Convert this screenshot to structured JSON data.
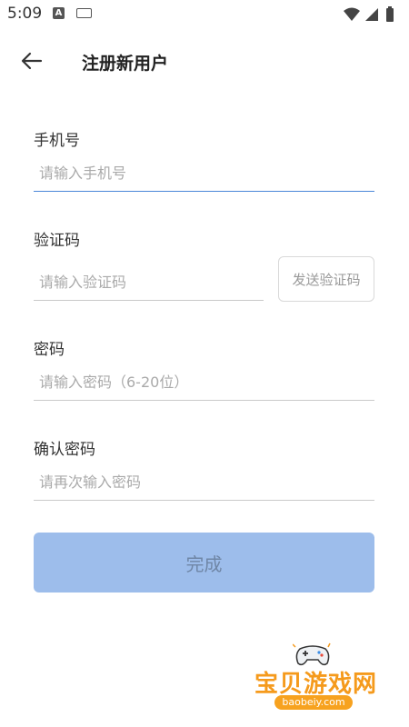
{
  "status_bar": {
    "time": "5:09",
    "left_icons": [
      "a-notification-icon",
      "keyboard-icon"
    ],
    "right_icons": [
      "wifi-icon",
      "signal-icon",
      "battery-icon"
    ]
  },
  "header": {
    "title": "注册新用户",
    "back_icon": "arrow-left-icon"
  },
  "form": {
    "phone": {
      "label": "手机号",
      "placeholder": "请输入手机号",
      "value": ""
    },
    "code": {
      "label": "验证码",
      "placeholder": "请输入验证码",
      "value": "",
      "send_button": "发送验证码"
    },
    "password": {
      "label": "密码",
      "placeholder": "请输入密码（6-20位）",
      "value": ""
    },
    "confirm_password": {
      "label": "确认密码",
      "placeholder": "请再次输入密码",
      "value": ""
    },
    "submit_label": "完成"
  },
  "watermark": {
    "text": "宝贝游戏网",
    "url": "baobeiy.com"
  },
  "colors": {
    "accent": "#4a86d8",
    "submit_bg": "#9dbdeb",
    "placeholder": "#aaaaaa",
    "watermark": "#f59a1c"
  }
}
